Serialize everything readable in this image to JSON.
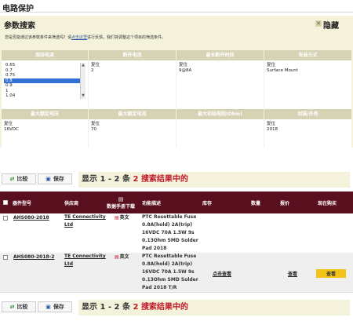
{
  "page": {
    "title": "电路保护"
  },
  "search_panel": {
    "heading": "参数搜索",
    "hide_label": "隐藏",
    "hint_before": "您是否能通过该参数条件来筛选吗？请",
    "hint_link": "点击这里",
    "hint_after": "进行反馈，我们将调整这个项目的筛选条件。"
  },
  "filters_top": [
    {
      "header": "保持电流",
      "options": [
        "0.65",
        "0.7",
        "0.75",
        "0.8",
        "0.9",
        "1",
        "1.04"
      ],
      "selected": "0.8"
    },
    {
      "header": "断开电流",
      "values": [
        "复位",
        "2"
      ]
    },
    {
      "header": "最长断开时间",
      "values": [
        "复位",
        "9@8A"
      ]
    },
    {
      "header": "安装方式",
      "values": [
        "复位",
        "Surface Mount"
      ]
    }
  ],
  "filters_bottom": [
    {
      "header": "最大额定电压",
      "values": [
        "复位",
        "16VDC"
      ]
    },
    {
      "header": "最大额定电流",
      "values": [
        "复位",
        "70"
      ]
    },
    {
      "header": "最大初始电阻(Ohm)",
      "values": []
    },
    {
      "header": "封装/外壳",
      "values": [
        "复位",
        "2018"
      ]
    }
  ],
  "toolbar": {
    "compare_label": "比较",
    "save_label": "保存"
  },
  "results_banner": {
    "prefix": "显示 1 - 2 条",
    "count": "2",
    "suffix": "搜索结果中的"
  },
  "table": {
    "headers": {
      "part_number": "器件型号",
      "supplier": "供应商",
      "datasheet": "数据手册下载",
      "description": "功能描述",
      "stock": "库存",
      "quantity": "数量",
      "price": "报价",
      "purchase": "现在购买"
    },
    "rows": [
      {
        "part_number": "AHS080-2018",
        "supplier": [
          "TE Connectivity",
          "Ltd"
        ],
        "datasheet": "英文",
        "description": [
          "PTC Resettable Fuse",
          "0.8A(hold) 2A(trip)",
          "16VDC 70A 1.5W 9s",
          "0.13Ohm SMD Solder",
          "Pad 2018"
        ],
        "stock": "",
        "price": "",
        "purchase": ""
      },
      {
        "part_number": "AHS080-2018-2",
        "supplier": [
          "TE Connectivity",
          "Ltd"
        ],
        "datasheet": "英文",
        "description": [
          "PTC Resettable Fuse",
          "0.8A(hold) 2A(trip)",
          "16VDC 70A 1.5W 9s",
          "0.13Ohm SMD Solder",
          "Pad 2018 T/R"
        ],
        "stock": "点击查看",
        "price": "查看",
        "purchase": "查看"
      }
    ]
  },
  "colors": {
    "table_header": "#5a0f1f",
    "panel_bg": "#f4f2da",
    "accent_red": "#c0182a",
    "view_button": "#f2c419"
  },
  "icons": {
    "compare": "arrows-icon",
    "save": "save-icon",
    "pdf": "pdf-icon",
    "hide": "close-icon"
  }
}
